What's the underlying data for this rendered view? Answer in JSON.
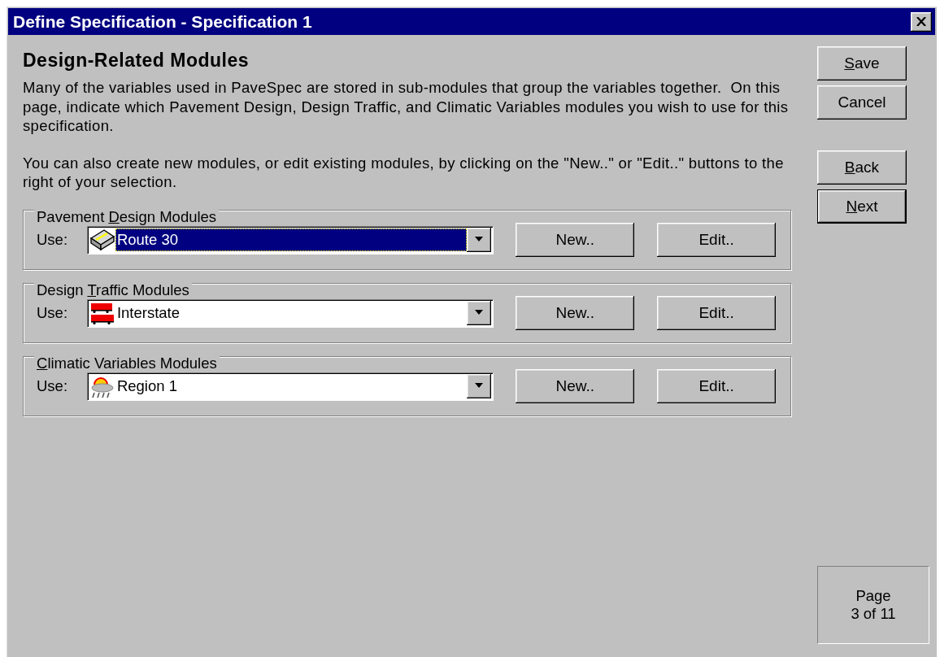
{
  "window": {
    "title": "Define Specification - Specification 1"
  },
  "heading": "Design-Related Modules",
  "paragraphs": [
    "Many of the variables used in PaveSpec are stored in sub-modules that group the variables together.  On this page, indicate which Pavement Design, Design Traffic, and Climatic Variables modules you wish to use for this specification.",
    "You can also create new modules, or edit existing modules, by clicking on the \"New..\" or \"Edit..\" buttons to the right of your selection."
  ],
  "groups": [
    {
      "label_before": "Pavement ",
      "label_key": "D",
      "label_after": "esign Modules",
      "use_label": "Use:",
      "value": "Route 30",
      "kind": "pavement",
      "selected": true,
      "buttons": [
        "New..",
        "Edit.."
      ]
    },
    {
      "label_before": "Design ",
      "label_key": "T",
      "label_after": "raffic Modules",
      "use_label": "Use:",
      "value": "Interstate",
      "kind": "traffic",
      "selected": false,
      "buttons": [
        "New..",
        "Edit.."
      ]
    },
    {
      "label_key": "C",
      "label_after": "limatic Variables Modules",
      "use_label": "Use:",
      "value": "Region 1",
      "kind": "climate",
      "selected": false,
      "buttons": [
        "New..",
        "Edit.."
      ]
    }
  ],
  "action_groups": [
    [
      {
        "label_key": "S",
        "label_after": "ave",
        "default": false
      },
      {
        "label_after": "Cancel",
        "default": false
      }
    ],
    [
      {
        "label_key": "B",
        "label_after": "ack",
        "default": false
      },
      {
        "label_key": "N",
        "label_after": "ext",
        "default": true
      }
    ]
  ],
  "page_indicator": "Page\n3 of 11"
}
